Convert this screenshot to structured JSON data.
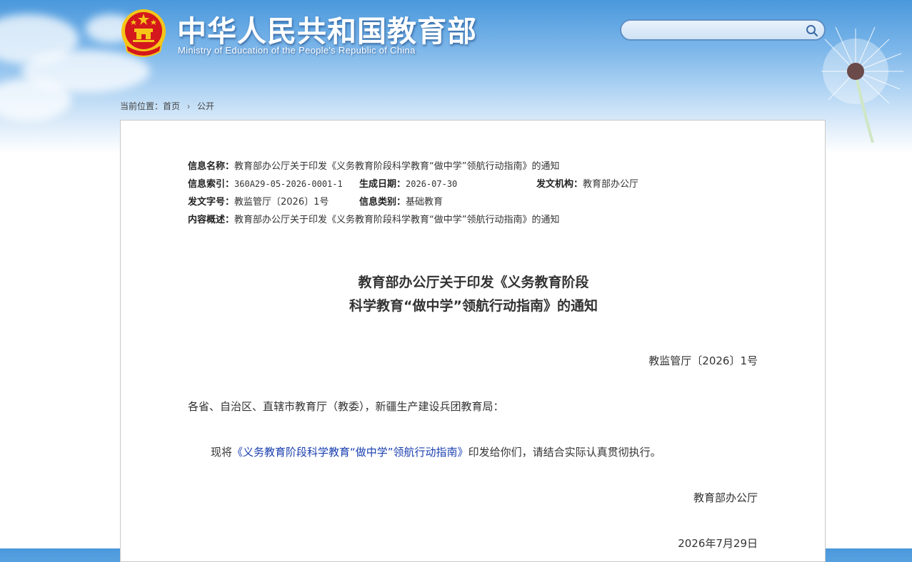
{
  "header": {
    "site_title": "中华人民共和国教育部",
    "site_subtitle": "Ministry of Education of the People's Republic of China",
    "search_placeholder": ""
  },
  "breadcrumb": {
    "label": "当前位置：",
    "items": [
      "首页",
      "公开"
    ],
    "separator": "›"
  },
  "meta": {
    "name_label": "信息名称：",
    "name_value": "教育部办公厅关于印发《义务教育阶段科学教育“做中学”领航行动指南》的通知",
    "index_label": "信息索引：",
    "index_value": "360A29-05-2026-0001-1",
    "date_label": "生成日期：",
    "date_value": "2026-07-30",
    "org_label": "发文机构：",
    "org_value": "教育部办公厅",
    "docno_label": "发文字号：",
    "docno_value": "教监管厅〔2026〕1号",
    "category_label": "信息类别：",
    "category_value": "基础教育",
    "summary_label": "内容概述：",
    "summary_value": "教育部办公厅关于印发《义务教育阶段科学教育“做中学”领航行动指南》的通知"
  },
  "article": {
    "title_line1": "教育部办公厅关于印发《义务教育阶段",
    "title_line2": "科学教育“做中学”领航行动指南》的通知",
    "doc_number": "教监管厅〔2026〕1号",
    "addressee": "各省、自治区、直辖市教育厅（教委），新疆生产建设兵团教育局：",
    "body_prefix": "现将",
    "body_link": "《义务教育阶段科学教育“做中学”领航行动指南》",
    "body_suffix": "印发给你们，请结合实际认真贯彻执行。",
    "signature": "教育部办公厅",
    "date": "2026年7月29日"
  },
  "colors": {
    "header_blue": "#4a98dc",
    "link": "#1a3fb0",
    "emblem_red": "#d4171d",
    "emblem_gold": "#f5c518"
  },
  "icons": [
    "national-emblem-icon",
    "search-icon",
    "dandelion-decoration"
  ]
}
